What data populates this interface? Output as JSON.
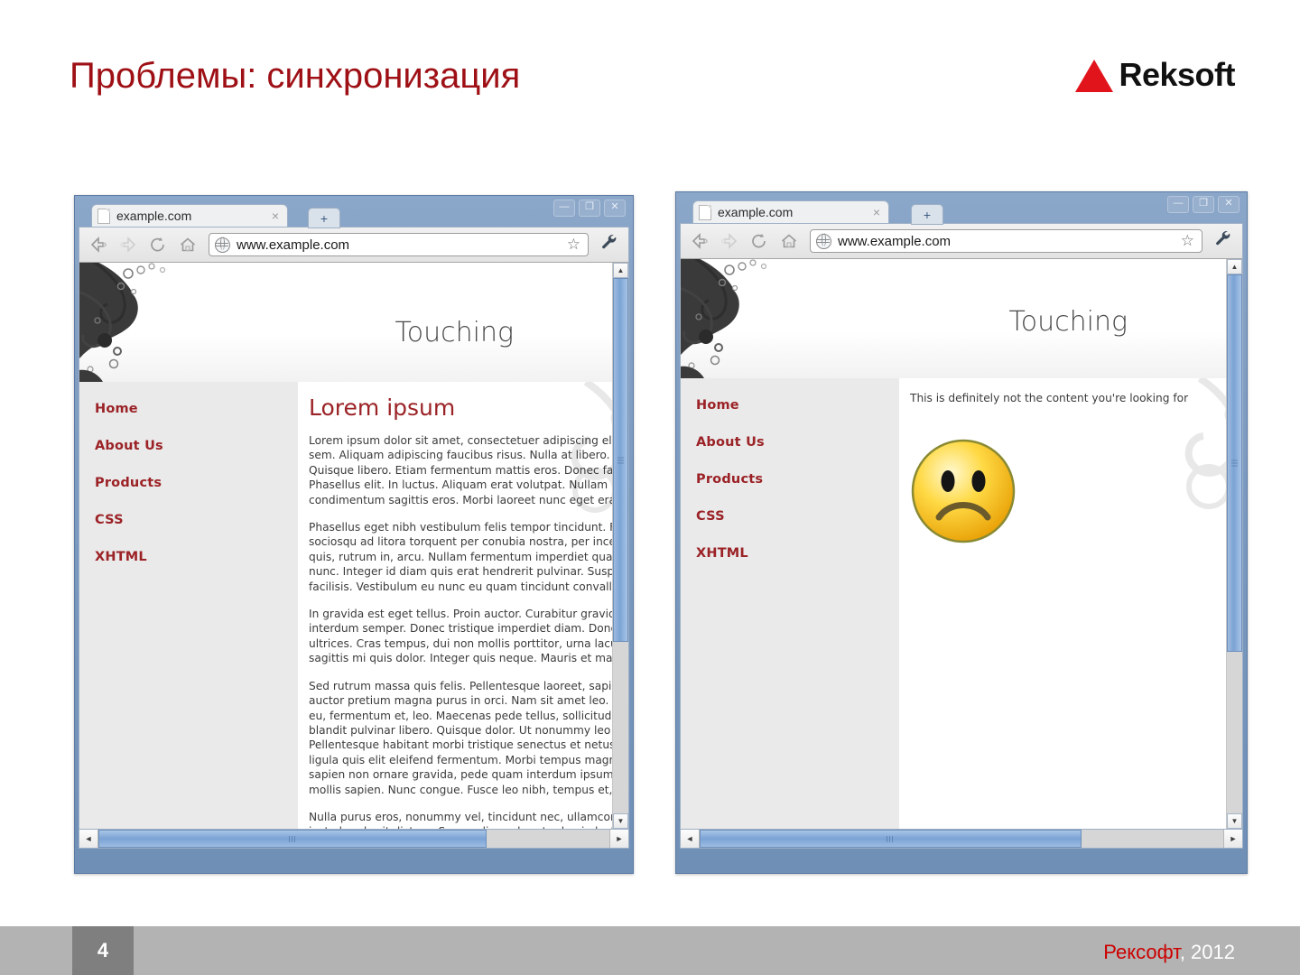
{
  "slide": {
    "title": "Проблемы: синхронизация",
    "page_number": "4"
  },
  "logo": {
    "text": "Reksoft",
    "mark_color": "#e1141b"
  },
  "footer": {
    "company": "Рексофт",
    "year": ", 2012"
  },
  "browsers": [
    {
      "tab_label": "example.com",
      "tab_close": "×",
      "new_tab": "+",
      "minimize": "—",
      "maximize": "❐",
      "close": "✕",
      "url": "www.example.com",
      "star_icon": "☆",
      "wrench_icon": "🔧",
      "site_title": "Touching",
      "nav": [
        "Home",
        "About Us",
        "Products",
        "CSS",
        "XHTML"
      ],
      "content_heading": "Lorem ipsum",
      "paragraphs": [
        "Lorem ipsum dolor sit amet, consectetuer adipiscing elit. Cur\nsem. Aliquam adipiscing faucibus risus. Nulla at libero. Vivar\nQuisque libero. Etiam fermentum mattis eros. Donec faucibus\nPhasellus elit. In luctus. Aliquam erat volutpat. Nullam imperd\ncondimentum sagittis eros. Morbi laoreet nunc eget erat. Dui",
        "Phasellus eget nibh vestibulum felis tempor tincidunt. Fusce\nsociosqu ad litora torquent per conubia nostra, per inceptos\nquis, rutrum in, arcu. Nullam fermentum imperdiet quam. Pelle\nnunc. Integer id diam quis erat hendrerit pulvinar. Suspendis\nfacilisis. Vestibulum eu nunc eu quam tincidunt convallis. Pro",
        "In gravida est eget tellus. Proin auctor. Curabitur gravida ligu\ninterdum semper. Donec tristique imperdiet diam. Donec male\nultrices. Cras tempus, dui non mollis porttitor, urna lacus lao\nsagittis mi quis dolor. Integer quis neque. Mauris et magna. N",
        "Sed rutrum massa quis felis. Pellentesque laoreet, sapien ne\nauctor pretium magna purus in orci. Nam sit amet leo. Proin r\neu, fermentum et, leo. Maecenas pede tellus, sollicitudin vulp\nblandit pulvinar libero. Quisque dolor. Ut nonummy leo non n\nPellentesque habitant morbi tristique senectus et netus et ma\nligula quis elit eleifend fermentum. Morbi tempus magna nec\nsapien non ornare gravida, pede quam interdum ipsum, ut no\nmollis sapien. Nunc congue. Fusce leo nibh, tempus et, pulvi",
        "Nulla purus eros, nonummy vel, tincidunt nec, ullamcorper m\njusto hendrerit dictum. Suspendisse pharetra leo in lectus. D\nvel massa. Fusce arcu erat, ultrices ac, fringilla eu, iaculis e\nest risus dapibus risus, sed sagittis nisl erat nec nisl. Nulla v"
      ],
      "scroll_up": "▲",
      "scroll_down": "▼",
      "scroll_left": "◄",
      "scroll_right": "►"
    },
    {
      "tab_label": "example.com",
      "tab_close": "×",
      "new_tab": "+",
      "minimize": "—",
      "maximize": "❐",
      "close": "✕",
      "url": "www.example.com",
      "star_icon": "☆",
      "wrench_icon": "🔧",
      "site_title": "Touching",
      "nav": [
        "Home",
        "About Us",
        "Products",
        "CSS",
        "XHTML"
      ],
      "not_found_message": "This is definitely not the content you're looking for",
      "face_icon": "sad-face",
      "scroll_up": "▲",
      "scroll_down": "▼",
      "scroll_left": "◄",
      "scroll_right": "►"
    }
  ]
}
